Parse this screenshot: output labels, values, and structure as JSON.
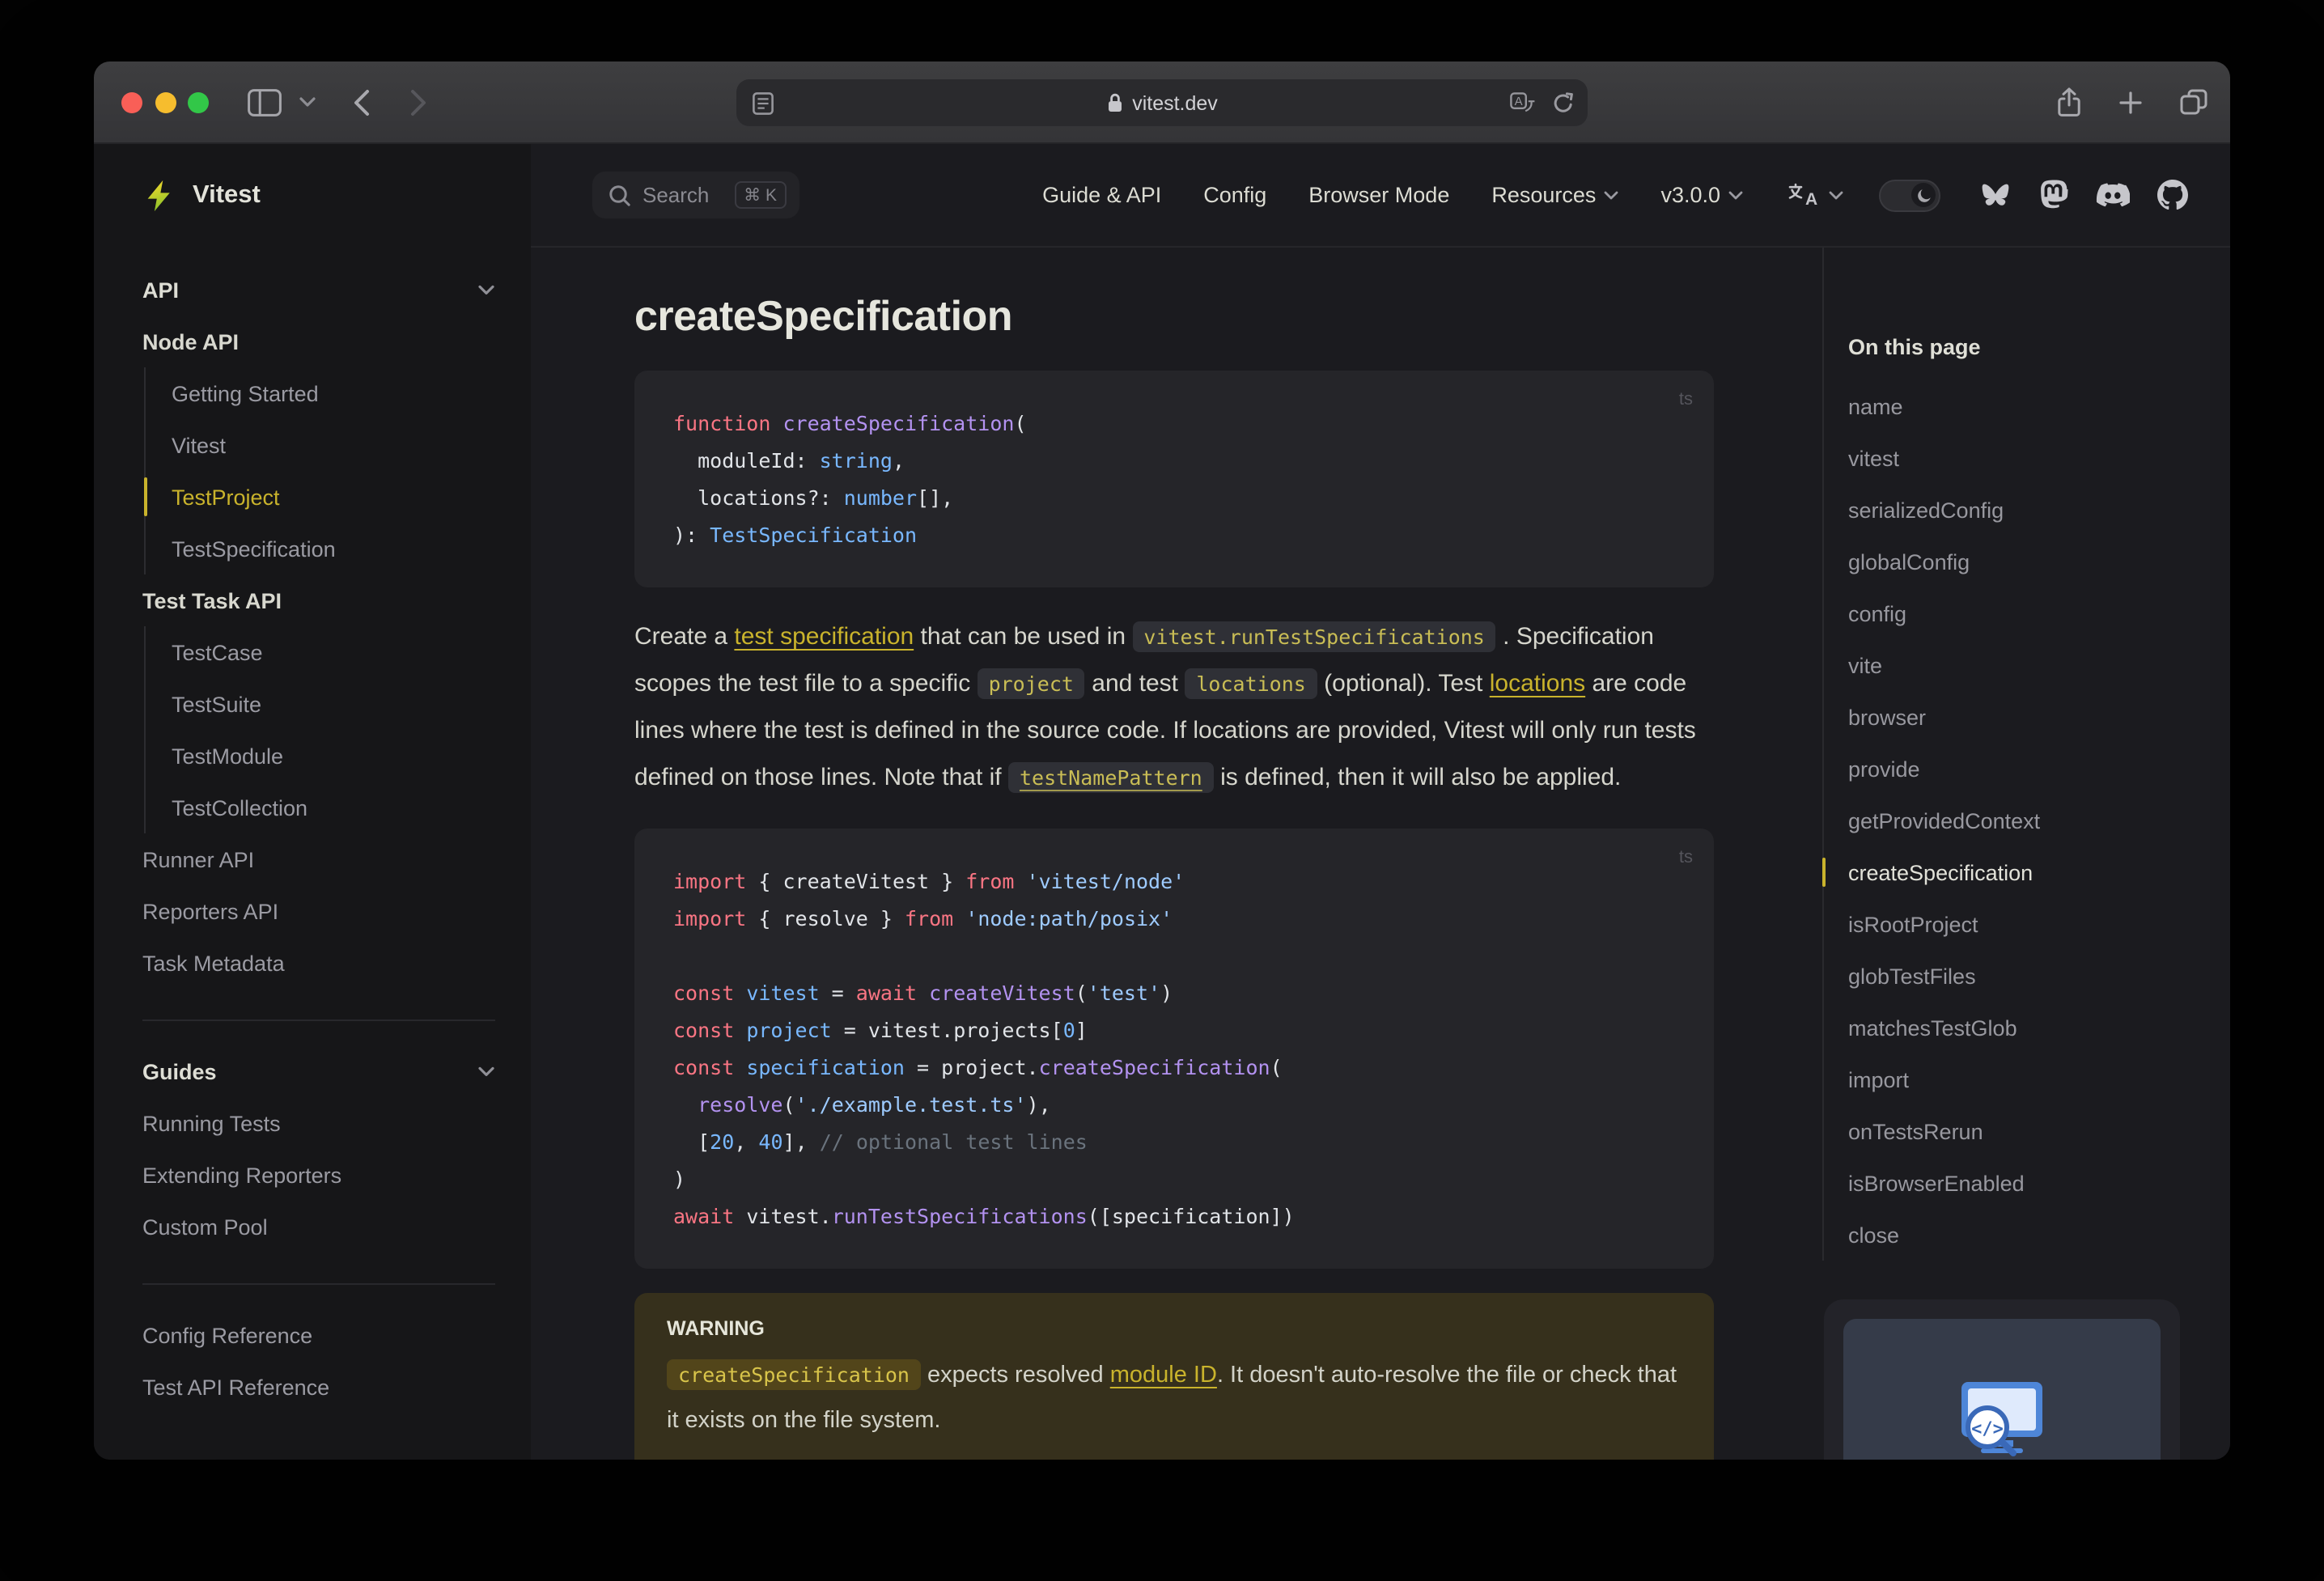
{
  "titlebar": {
    "url": "vitest.dev"
  },
  "nav": {
    "search": {
      "label": "Search",
      "kbd": "⌘ K"
    },
    "links": [
      {
        "label": "Guide & API",
        "chevron": false
      },
      {
        "label": "Config",
        "chevron": false
      },
      {
        "label": "Browser Mode",
        "chevron": false
      },
      {
        "label": "Resources",
        "chevron": true
      },
      {
        "label": "v3.0.0",
        "chevron": true
      }
    ]
  },
  "sidebar": {
    "logo_text": "Vitest",
    "groups": [
      {
        "header": "API",
        "items": [
          {
            "label": "Node API",
            "kind": "section"
          },
          {
            "label": "Getting Started",
            "kind": "sub"
          },
          {
            "label": "Vitest",
            "kind": "sub"
          },
          {
            "label": "TestProject",
            "kind": "sub",
            "active": true
          },
          {
            "label": "TestSpecification",
            "kind": "sub"
          },
          {
            "label": "Test Task API",
            "kind": "section"
          },
          {
            "label": "TestCase",
            "kind": "sub"
          },
          {
            "label": "TestSuite",
            "kind": "sub"
          },
          {
            "label": "TestModule",
            "kind": "sub"
          },
          {
            "label": "TestCollection",
            "kind": "sub"
          },
          {
            "label": "Runner API",
            "kind": "top"
          },
          {
            "label": "Reporters API",
            "kind": "top"
          },
          {
            "label": "Task Metadata",
            "kind": "top"
          }
        ]
      },
      {
        "header": "Guides",
        "items": [
          {
            "label": "Running Tests",
            "kind": "top"
          },
          {
            "label": "Extending Reporters",
            "kind": "top"
          },
          {
            "label": "Custom Pool",
            "kind": "top"
          }
        ]
      },
      {
        "header": null,
        "items": [
          {
            "label": "Config Reference",
            "kind": "top"
          },
          {
            "label": "Test API Reference",
            "kind": "top"
          }
        ]
      }
    ]
  },
  "page": {
    "title": "createSpecification",
    "code_blocks": [
      {
        "lang": "ts",
        "lines": [
          [
            {
              "t": "function ",
              "c": "k"
            },
            {
              "t": "createSpecification",
              "c": "f"
            },
            {
              "t": "(",
              "c": "p"
            }
          ],
          [
            {
              "t": "  moduleId: ",
              "c": "p"
            },
            {
              "t": "string",
              "c": "n"
            },
            {
              "t": ",",
              "c": "p"
            }
          ],
          [
            {
              "t": "  locations?: ",
              "c": "p"
            },
            {
              "t": "number",
              "c": "n"
            },
            {
              "t": "[],",
              "c": "p"
            }
          ],
          [
            {
              "t": "): ",
              "c": "p"
            },
            {
              "t": "TestSpecification",
              "c": "n"
            }
          ]
        ]
      },
      {
        "lang": "ts",
        "lines": [
          [
            {
              "t": "import ",
              "c": "k"
            },
            {
              "t": "{ createVitest } ",
              "c": "p"
            },
            {
              "t": "from ",
              "c": "k"
            },
            {
              "t": "'vitest/node'",
              "c": "s"
            }
          ],
          [
            {
              "t": "import ",
              "c": "k"
            },
            {
              "t": "{ resolve } ",
              "c": "p"
            },
            {
              "t": "from ",
              "c": "k"
            },
            {
              "t": "'node:path/posix'",
              "c": "s"
            }
          ],
          [],
          [
            {
              "t": "const ",
              "c": "k"
            },
            {
              "t": "vitest",
              "c": "n"
            },
            {
              "t": " = ",
              "c": "p"
            },
            {
              "t": "await ",
              "c": "k"
            },
            {
              "t": "createVitest",
              "c": "f"
            },
            {
              "t": "(",
              "c": "p"
            },
            {
              "t": "'test'",
              "c": "s"
            },
            {
              "t": ")",
              "c": "p"
            }
          ],
          [
            {
              "t": "const ",
              "c": "k"
            },
            {
              "t": "project",
              "c": "n"
            },
            {
              "t": " = vitest.projects[",
              "c": "p"
            },
            {
              "t": "0",
              "c": "n"
            },
            {
              "t": "]",
              "c": "p"
            }
          ],
          [
            {
              "t": "const ",
              "c": "k"
            },
            {
              "t": "specification",
              "c": "n"
            },
            {
              "t": " = project.",
              "c": "p"
            },
            {
              "t": "createSpecification",
              "c": "f"
            },
            {
              "t": "(",
              "c": "p"
            }
          ],
          [
            {
              "t": "  ",
              "c": "p"
            },
            {
              "t": "resolve",
              "c": "f"
            },
            {
              "t": "(",
              "c": "p"
            },
            {
              "t": "'./example.test.ts'",
              "c": "s"
            },
            {
              "t": "),",
              "c": "p"
            }
          ],
          [
            {
              "t": "  [",
              "c": "p"
            },
            {
              "t": "20",
              "c": "n"
            },
            {
              "t": ", ",
              "c": "p"
            },
            {
              "t": "40",
              "c": "n"
            },
            {
              "t": "], ",
              "c": "p"
            },
            {
              "t": "// optional test lines",
              "c": "c"
            }
          ],
          [
            {
              "t": ")",
              "c": "p"
            }
          ],
          [
            {
              "t": "await ",
              "c": "k"
            },
            {
              "t": "vitest.",
              "c": "p"
            },
            {
              "t": "runTestSpecifications",
              "c": "f"
            },
            {
              "t": "([specification])",
              "c": "p"
            }
          ]
        ]
      }
    ],
    "paragraph": [
      {
        "k": "t",
        "t": "Create a "
      },
      {
        "k": "a",
        "t": "test specification"
      },
      {
        "k": "t",
        "t": " that can be used in "
      },
      {
        "k": "c",
        "t": "vitest.runTestSpecifications"
      },
      {
        "k": "t",
        "t": " . Specification scopes the test file to a specific "
      },
      {
        "k": "c",
        "t": "project"
      },
      {
        "k": "t",
        "t": " and test "
      },
      {
        "k": "c",
        "t": "locations"
      },
      {
        "k": "t",
        "t": " (optional). Test "
      },
      {
        "k": "a",
        "t": "locations"
      },
      {
        "k": "t",
        "t": " are code lines where the test is defined in the source code. If locations are provided, Vitest will only run tests defined on those lines. Note that if "
      },
      {
        "k": "cl",
        "t": "testNamePattern"
      },
      {
        "k": "t",
        "t": " is defined, then it will also be applied."
      }
    ],
    "warning": {
      "label": "WARNING",
      "runs": [
        {
          "k": "cw",
          "t": "createSpecification"
        },
        {
          "k": "t",
          "t": " expects resolved "
        },
        {
          "k": "a",
          "t": "module ID"
        },
        {
          "k": "t",
          "t": ". It doesn't auto-resolve the file or check that it exists on the file system."
        }
      ]
    }
  },
  "outline": {
    "title": "On this page",
    "items": [
      "name",
      "vitest",
      "serializedConfig",
      "globalConfig",
      "config",
      "vite",
      "browser",
      "provide",
      "getProvidedContext",
      "createSpecification",
      "isRootProject",
      "globTestFiles",
      "matchesTestGlob",
      "import",
      "onTestsRerun",
      "isBrowserEnabled",
      "close"
    ],
    "active_index": 9
  }
}
